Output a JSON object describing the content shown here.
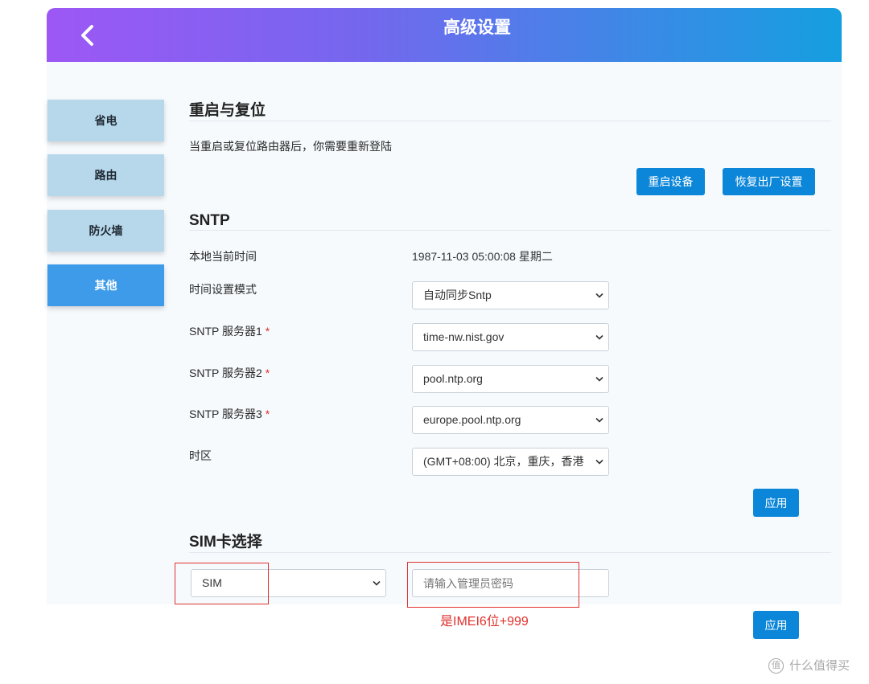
{
  "header": {
    "title": "高级设置",
    "back_icon": "chevron-left-icon"
  },
  "sidebar": {
    "items": [
      {
        "label": "省电",
        "active": false
      },
      {
        "label": "路由",
        "active": false
      },
      {
        "label": "防火墙",
        "active": false
      },
      {
        "label": "其他",
        "active": true
      }
    ]
  },
  "reboot_section": {
    "title": "重启与复位",
    "description": "当重启或复位路由器后，你需要重新登陆",
    "reboot_button": "重启设备",
    "reset_button": "恢复出厂设置"
  },
  "sntp_section": {
    "title": "SNTP",
    "required_mark": "*",
    "select_icon": "chevron-down-icon",
    "current_time": {
      "label": "本地当前时间",
      "value": "1987-11-03 05:00:08 星期二"
    },
    "mode": {
      "label": "时间设置模式",
      "value": "自动同步Sntp"
    },
    "server1": {
      "label": "SNTP 服务器1",
      "value": "time-nw.nist.gov"
    },
    "server2": {
      "label": "SNTP 服务器2",
      "value": "pool.ntp.org"
    },
    "server3": {
      "label": "SNTP 服务器3",
      "value": "europe.pool.ntp.org"
    },
    "timezone": {
      "label": "时区",
      "value": "(GMT+08:00) 北京，重庆，香港"
    },
    "apply_button": "应用"
  },
  "sim_section": {
    "title": "SIM卡选择",
    "sim_select_value": "SIM",
    "password_placeholder": "请输入管理员密码",
    "apply_button": "应用"
  },
  "annotation": {
    "note": "是IMEI6位+999"
  },
  "watermark": {
    "logo": "值",
    "text": "什么值得买"
  },
  "colors": {
    "header_start": "#9d57f5",
    "header_end": "#159fe0",
    "button": "#0b86d8",
    "sidebar_active": "#3e9be9",
    "sidebar_inactive": "#b7d7ea",
    "required": "#e0312d",
    "annotation": "#e0312d"
  }
}
